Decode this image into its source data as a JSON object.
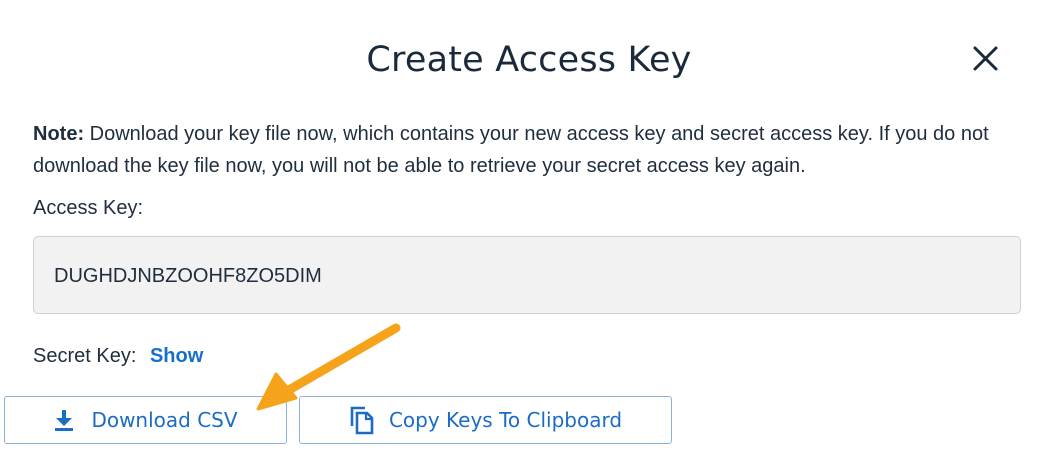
{
  "dialog": {
    "title": "Create Access Key",
    "close_icon": "close-icon"
  },
  "note": {
    "label": "Note:",
    "text": " Download your key file now, which contains your new access key and secret access key. If you do not download the key file now, you will not be able to retrieve your secret access key again."
  },
  "access_key": {
    "label": "Access Key:",
    "value": "DUGHDJNBZOOHF8ZO5DIM"
  },
  "secret_key": {
    "label": "Secret Key:",
    "show_label": "Show"
  },
  "buttons": {
    "download_label": "Download CSV",
    "download_icon": "download-icon",
    "copy_label": "Copy Keys To Clipboard",
    "copy_icon": "copy-icon"
  },
  "colors": {
    "accent": "#1c6cc4",
    "annotation_arrow": "#f5a31a",
    "field_background": "#f2f2f2"
  }
}
